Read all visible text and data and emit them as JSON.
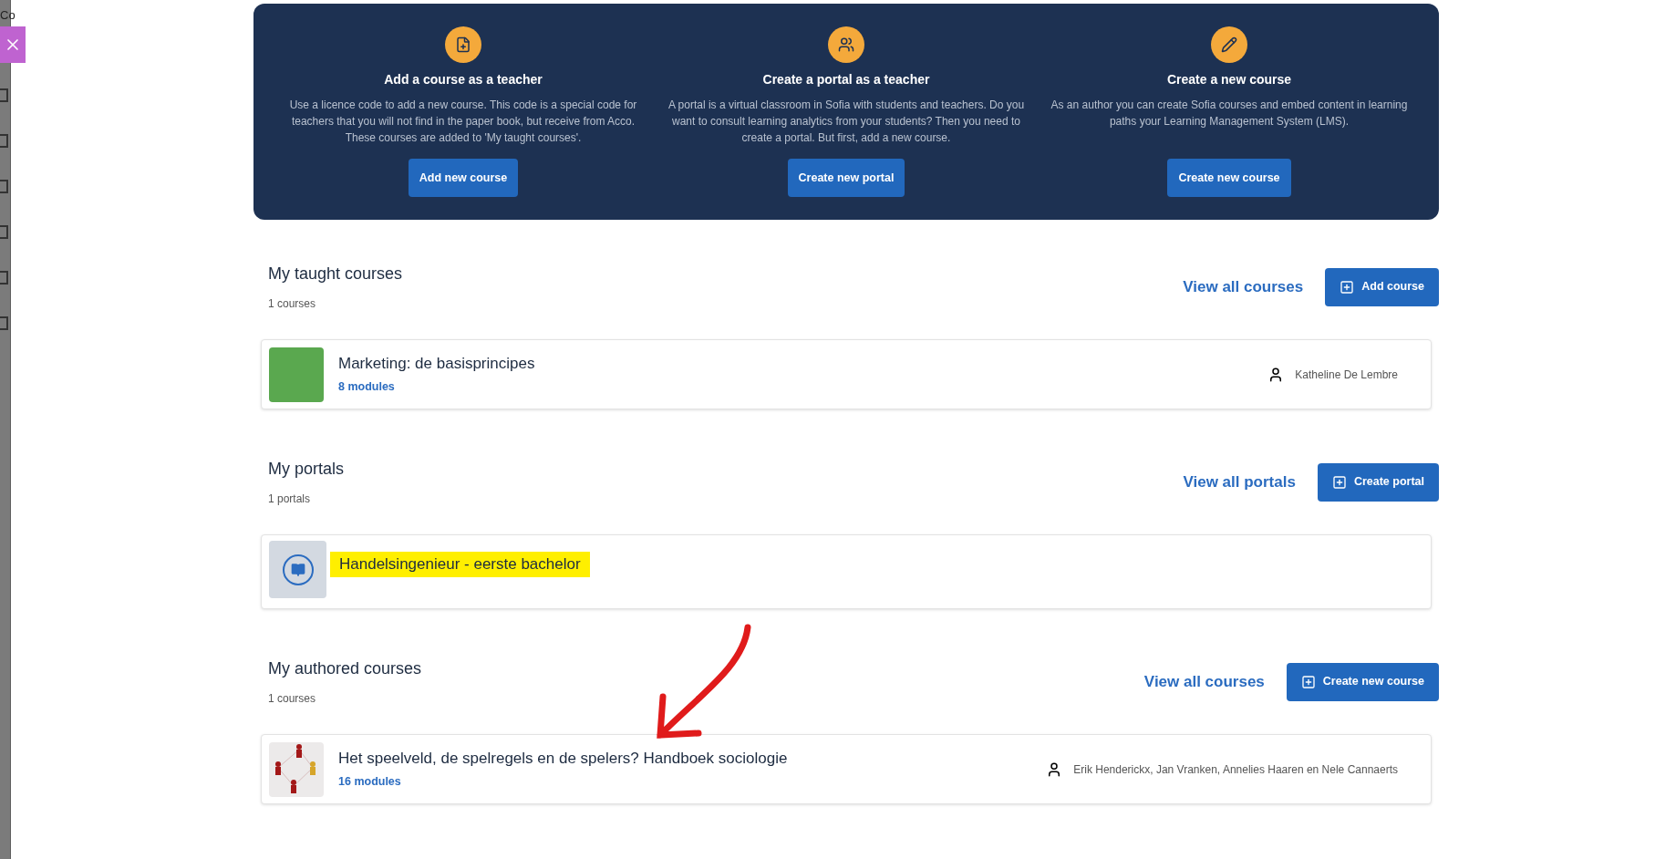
{
  "side_panel": {
    "text": "Co"
  },
  "banner": {
    "cards": [
      {
        "title": "Add a course as a teacher",
        "description": "Use a licence code to add a new course. This code is a special code for teachers that you will not find in the paper book, but receive from Acco. These courses are added to 'My taught courses'.",
        "button": "Add new course"
      },
      {
        "title": "Create a portal as a teacher",
        "description": "A portal is a virtual classroom in Sofia with students and teachers. Do you want to consult learning analytics from your students? Then you need to create a portal. But first, add a new course.",
        "button": "Create new portal"
      },
      {
        "title": "Create a new course",
        "description": "As an author you can create Sofia courses and embed content in learning paths your Learning Management System (LMS).",
        "button": "Create new course"
      }
    ]
  },
  "sections": [
    {
      "title": "My taught courses",
      "count": "1 courses",
      "view_all": "View all courses",
      "action": "Add course",
      "items": [
        {
          "kind": "course",
          "title": "Marketing: de basisprincipes",
          "modules": "8 modules",
          "people": "Katheline De Lembre",
          "highlighted": false
        }
      ]
    },
    {
      "title": "My portals",
      "count": "1 portals",
      "view_all": "View all portals",
      "action": "Create portal",
      "items": [
        {
          "kind": "portal",
          "title": "Handelsingenieur - eerste bachelor",
          "highlighted": true
        }
      ]
    },
    {
      "title": "My authored courses",
      "count": "1 courses",
      "view_all": "View all courses",
      "action": "Create new course",
      "items": [
        {
          "kind": "course",
          "title": "Het speelveld, de spelregels en de spelers? Handboek sociologie",
          "modules": "16 modules",
          "people": "Erik Henderickx, Jan Vranken, Annelies Haaren en Nele Cannaerts",
          "highlighted": false
        }
      ]
    }
  ]
}
